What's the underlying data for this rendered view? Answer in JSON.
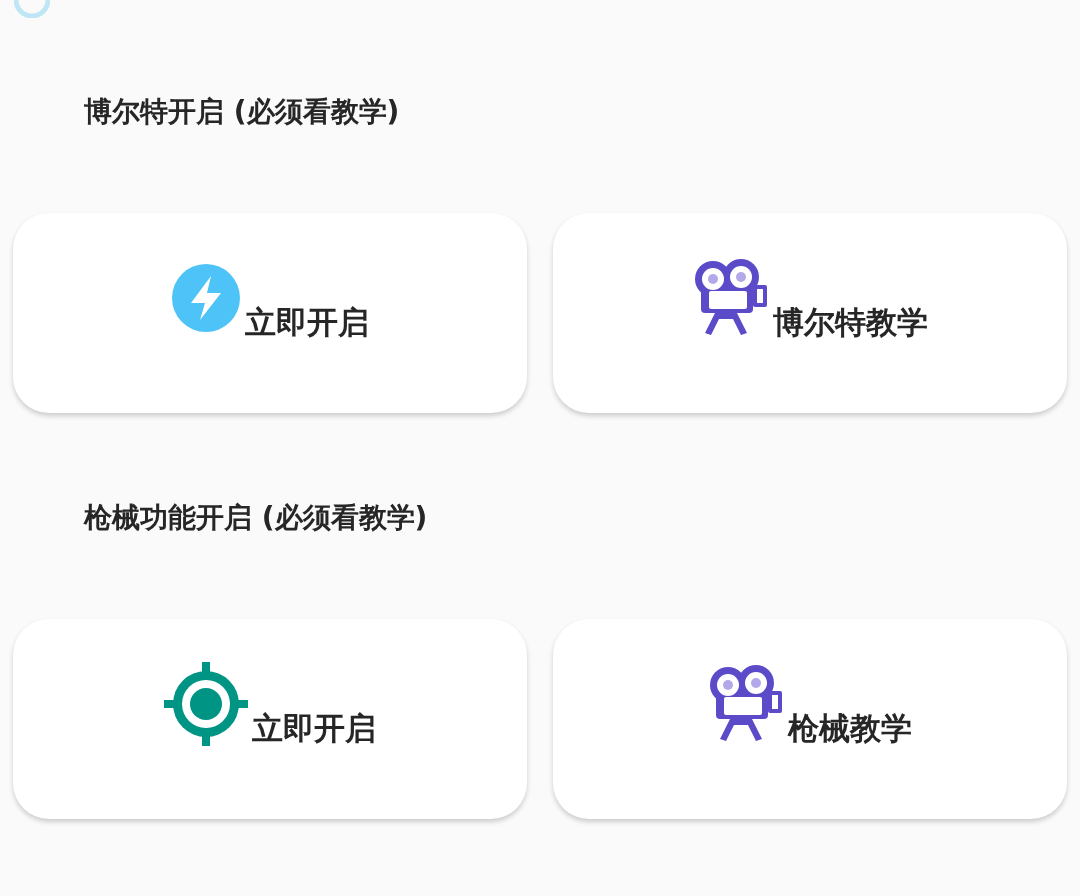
{
  "sections": [
    {
      "title": "博尔特开启 (必须看教学)",
      "buttons": [
        {
          "kind": "bolt",
          "label": "立即开启"
        },
        {
          "kind": "camera",
          "label": "博尔特教学"
        }
      ]
    },
    {
      "title": "枪械功能开启 (必须看教学)",
      "buttons": [
        {
          "kind": "target",
          "label": "立即开启"
        },
        {
          "kind": "camera",
          "label": "枪械教学"
        }
      ]
    }
  ]
}
